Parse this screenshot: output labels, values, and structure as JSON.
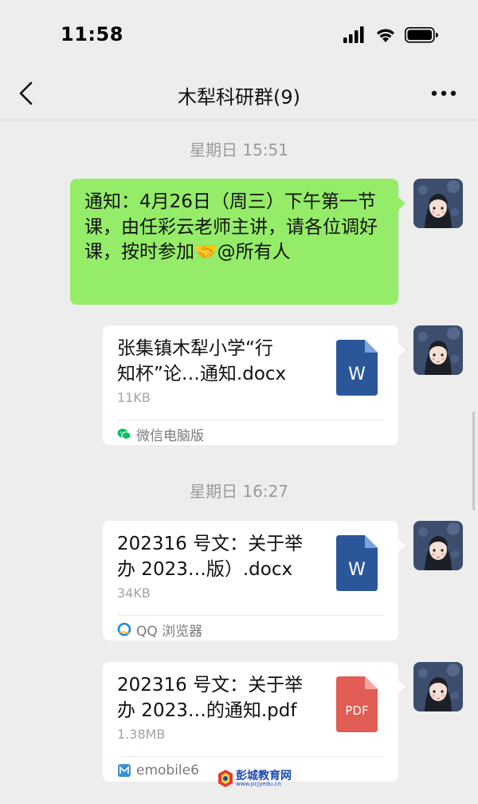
{
  "status_bar": {
    "time": "11:58"
  },
  "nav": {
    "title": "木犁科研群(9)"
  },
  "chat": {
    "time_sep_1": "星期日 15:51",
    "time_sep_2": "星期日 16:27",
    "text_message": "通知：4月26日（周三）下午第一节课，由任彩云老师主讲，请各位调好课，按时参加🤝@所有人",
    "files": [
      {
        "name": "张集镇木犁小学“行\n知杯”论…通知.docx",
        "size": "11KB",
        "type_label": "W",
        "type": "word",
        "source": "微信电脑版",
        "source_icon": "wechat-icon"
      },
      {
        "name": "202316 号文：关于举\n办 2023…版）.docx",
        "size": "34KB",
        "type_label": "W",
        "type": "word",
        "source": "QQ 浏览器",
        "source_icon": "qq-browser-icon"
      },
      {
        "name": "202316 号文：关于举\n办 2023…的通知.pdf",
        "size": "1.38MB",
        "type_label": "PDF",
        "type": "pdf",
        "source": "emobile6",
        "source_icon": "emobile-icon"
      }
    ]
  },
  "watermark": {
    "title": "彭城教育网",
    "url": "www.pcjyedu.cn"
  },
  "colors": {
    "background": "#ededed",
    "bubble_green": "#95ec69",
    "word_blue": "#2b579a",
    "pdf_red": "#e15c54"
  }
}
